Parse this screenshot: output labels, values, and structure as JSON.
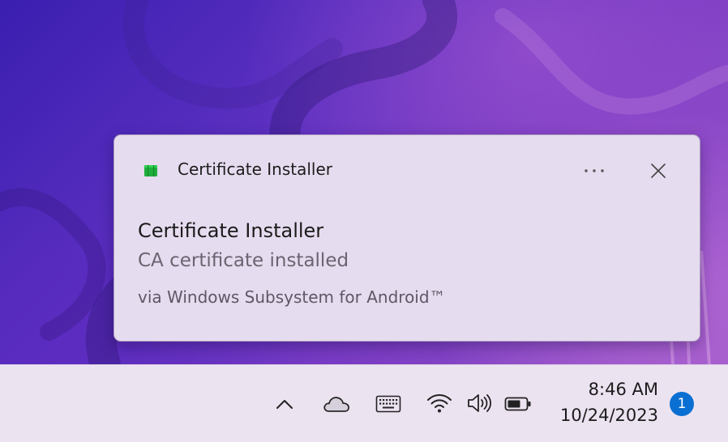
{
  "notification": {
    "app_name": "Certificate Installer",
    "title": "Certificate Installer",
    "body": "CA certificate installed",
    "attribution": "via Windows Subsystem for Android™",
    "app_icon": "green-cube-icon",
    "more_icon": "more-options-icon",
    "close_icon": "close-icon"
  },
  "taskbar": {
    "tray_icons": [
      "chevron-up-icon",
      "onedrive-cloud-icon",
      "touch-keyboard-icon",
      "wifi-icon",
      "speaker-icon",
      "battery-icon"
    ],
    "clock": {
      "time": "8:46 AM",
      "date": "10/24/2023"
    },
    "notification_count": "1"
  },
  "colors": {
    "accent": "#0a6fd2",
    "toast_background": "#e6dcef",
    "taskbar_background": "#ece3f1",
    "app_icon_green": "#1fae3c"
  }
}
